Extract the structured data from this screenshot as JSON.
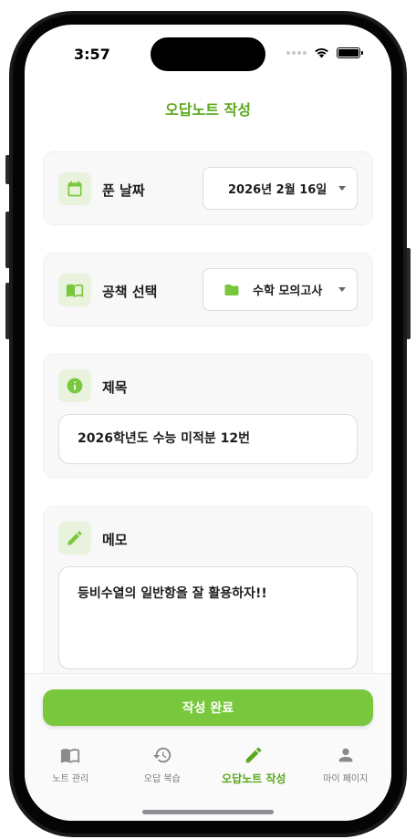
{
  "status_bar": {
    "time": "3:57"
  },
  "header": {
    "title": "오답노트 작성"
  },
  "date_section": {
    "label": "푼 날짜",
    "value": "2026년 2월 16일"
  },
  "workbook_section": {
    "label": "공책 선택",
    "value": "수학 모의고사"
  },
  "title_section": {
    "label": "제목",
    "value": "2026학년도 수능 미적분 12번"
  },
  "memo_section": {
    "label": "메모",
    "value": "등비수열의 일반항을 잘 활용하자!!"
  },
  "submit_label": "작성 완료",
  "tabs": [
    {
      "label": "노트 관리",
      "icon": "book-icon",
      "active": false
    },
    {
      "label": "오답 복습",
      "icon": "history-icon",
      "active": false
    },
    {
      "label": "오답노트 작성",
      "icon": "pencil-icon",
      "active": true
    },
    {
      "label": "마이 페이지",
      "icon": "person-icon",
      "active": false
    }
  ],
  "colors": {
    "accent": "#78c73c",
    "accent_text": "#5aa71b",
    "icon_bg": "#e8f2dd"
  }
}
